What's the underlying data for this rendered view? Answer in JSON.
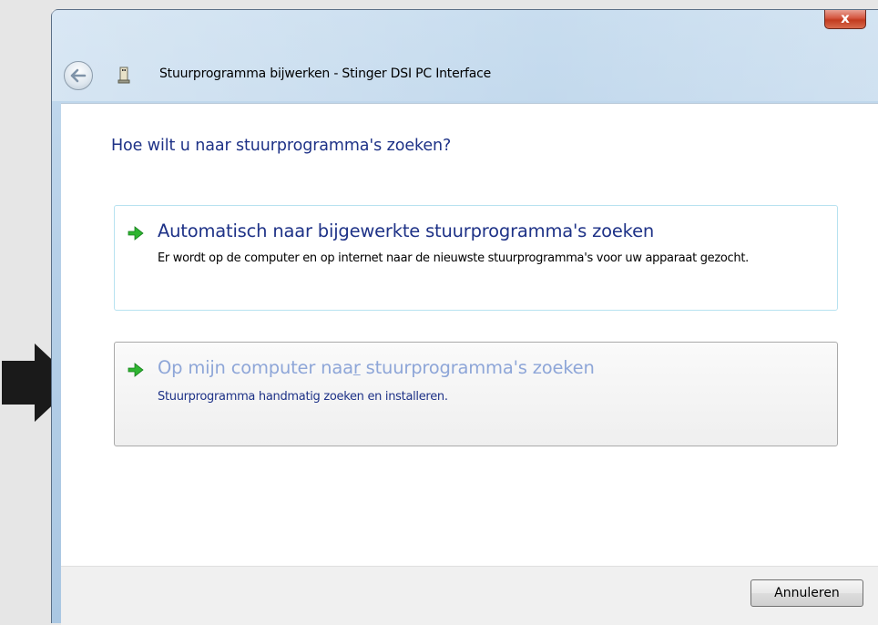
{
  "window": {
    "title": "Stuurprogramma bijwerken - Stinger DSI PC Interface",
    "close_label": "x"
  },
  "question": "Hoe wilt u naar stuurprogramma's zoeken?",
  "options": [
    {
      "title": "Automatisch naar bijgewerkte stuurprogramma's zoeken",
      "description": "Er wordt op de computer en op internet naar de nieuwste stuurprogramma's voor uw apparaat gezocht."
    },
    {
      "title_pre": "Op mijn computer naa",
      "title_accel": "r",
      "title_post": " stuurprogramma's zoeken",
      "description": "Stuurprogramma handmatig zoeken en installeren."
    }
  ],
  "footer": {
    "cancel_label": "Annuleren"
  },
  "colors": {
    "accent_blue": "#1e3287",
    "arrow_green": "#2fb531",
    "pointer_arrow": "#1a1a1a"
  },
  "icons": {
    "pointer": "right-arrow-icon",
    "back": "back-arrow-icon",
    "device": "usb-device-icon",
    "option_arrow": "green-arrow-icon"
  }
}
